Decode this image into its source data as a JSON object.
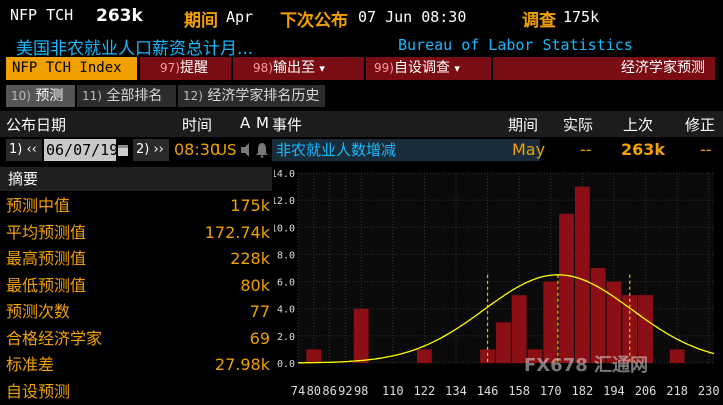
{
  "header": {
    "ticker": "NFP TCH",
    "value": "263k",
    "period_label": "期间",
    "period_value": "Apr",
    "next_release_label": "下次公布",
    "next_release_value": "07 Jun 08:30",
    "survey_label": "调查",
    "survey_value": "175k",
    "description": "美国非农就业人口薪资总计月...",
    "source": "Bureau of Labor Statistics"
  },
  "function_bar": {
    "index_label": "NFP TCH Index",
    "btn_alert_num": "97)",
    "btn_alert_label": "提醒",
    "btn_output_num": "98)",
    "btn_output_label": "输出至",
    "btn_custom_num": "99)",
    "btn_custom_label": "自设调查",
    "title": "经济学家预测",
    "dropdown_glyph": "▾"
  },
  "tabs": [
    {
      "num": "10)",
      "label": "预测"
    },
    {
      "num": "11)",
      "label": "全部排名"
    },
    {
      "num": "12)",
      "label": "经济学家排名历史"
    }
  ],
  "table_header": {
    "date": "公布日期",
    "time": "时间",
    "a": "A",
    "m": "M",
    "event": "事件",
    "period": "期间",
    "actual": "实际",
    "prior": "上次",
    "revised": "修正"
  },
  "event_row": {
    "prev_btn": "1) ‹‹",
    "date": "06/07/19",
    "next_btn": "2) ››",
    "time": "08:30",
    "country": "US",
    "name": "非农就业人数增减",
    "period": "May",
    "actual": "--",
    "prior": "263k",
    "revised": "--"
  },
  "summary": {
    "title": "摘要",
    "rows": [
      {
        "label": "预测中值",
        "value": "175k"
      },
      {
        "label": "平均预测值",
        "value": "172.74k"
      },
      {
        "label": "最高预测值",
        "value": "228k"
      },
      {
        "label": "最低预测值",
        "value": "80k"
      },
      {
        "label": "预测次数",
        "value": "77"
      },
      {
        "label": "合格经济学家",
        "value": "69"
      },
      {
        "label": "标准差",
        "value": "27.98k"
      },
      {
        "label": "自设预测",
        "value": ""
      }
    ]
  },
  "watermark": "FX678 汇通网",
  "colors": {
    "amber": "#f0a000",
    "cyan": "#18b8ff",
    "bar": "#8b0f14",
    "curve": "#ffff00"
  },
  "chart_data": {
    "type": "bar",
    "x_ticks": [
      74,
      80,
      86,
      92,
      98,
      110,
      122,
      134,
      146,
      158,
      170,
      182,
      194,
      206,
      218,
      230
    ],
    "y_ticks": [
      "0.0",
      "2.0",
      "4.0",
      "6.0",
      "8.0",
      "10.0",
      "12.0",
      "14.0"
    ],
    "ylim": [
      0,
      14
    ],
    "xlim": [
      74,
      232
    ],
    "bins": [
      {
        "x": 80,
        "count": 1
      },
      {
        "x": 98,
        "count": 4
      },
      {
        "x": 122,
        "count": 1
      },
      {
        "x": 146,
        "count": 1
      },
      {
        "x": 152,
        "count": 3
      },
      {
        "x": 158,
        "count": 5
      },
      {
        "x": 164,
        "count": 1
      },
      {
        "x": 170,
        "count": 6
      },
      {
        "x": 176,
        "count": 11
      },
      {
        "x": 182,
        "count": 13
      },
      {
        "x": 188,
        "count": 7
      },
      {
        "x": 194,
        "count": 6
      },
      {
        "x": 200,
        "count": 5
      },
      {
        "x": 206,
        "count": 5
      },
      {
        "x": 218,
        "count": 1
      }
    ],
    "bin_width": 6,
    "normal_curve": {
      "mean": 172.74,
      "sd": 27.98,
      "peak": 6.5
    },
    "vlines": [
      146,
      172.74,
      200
    ]
  }
}
